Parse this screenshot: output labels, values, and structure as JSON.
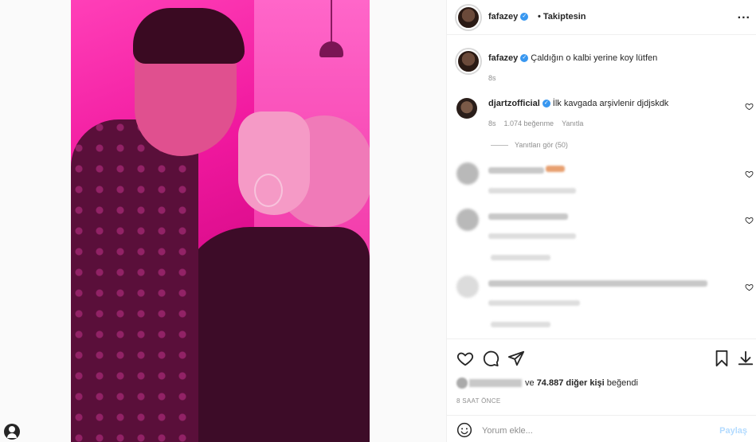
{
  "header": {
    "username": "fafazey",
    "follow_status": "• Takiptesin",
    "more_glyph": "..."
  },
  "caption": {
    "username": "fafazey",
    "text": "Çaldığın o kalbi yerine koy lütfen",
    "time": "8s"
  },
  "comments": [
    {
      "username": "djartzofficial",
      "text": "İlk kavgada arşivlenir djdjskdk",
      "time": "8s",
      "likes": "1.074 beğenme",
      "reply_label": "Yanıtla",
      "view_replies": "Yanıtları gör (50)"
    }
  ],
  "likes_line": {
    "text": "ve",
    "count": "74.887 diğer kişi",
    "suffix": "beğendi"
  },
  "posted_ago": "8 SAAT ÖNCE",
  "add_comment": {
    "placeholder": "Yorum ekle...",
    "post_label": "Paylaş"
  },
  "icons": {
    "verified": "verified-badge-icon",
    "like": "heart-icon",
    "comment": "comment-icon",
    "share": "share-icon",
    "save": "bookmark-icon",
    "download": "download-icon",
    "emoji": "smile-icon"
  },
  "colors": {
    "verified": "#3897f0",
    "media_tint": "#f0189e",
    "post_button": "#b3dbff"
  }
}
